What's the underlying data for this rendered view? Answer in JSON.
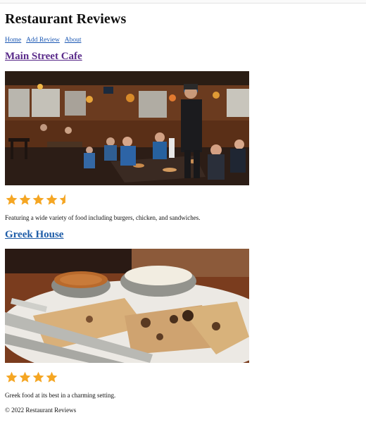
{
  "site": {
    "title": "Restaurant Reviews"
  },
  "nav": {
    "items": [
      {
        "label": "Home"
      },
      {
        "label": "Add Review"
      },
      {
        "label": "About"
      }
    ]
  },
  "restaurants": [
    {
      "name": "Main Street Cafe",
      "rating": 4.5,
      "max_rating": 5,
      "description": "Featuring a wide variety of food including burgers, chicken, and sandwiches."
    },
    {
      "name": "Greek House",
      "rating": 4,
      "max_rating": 5,
      "description": "Greek food at its best in a charming setting."
    }
  ],
  "footer": {
    "text": "© 2022 Restaurant Reviews"
  },
  "colors": {
    "star": "#f5a623",
    "link": "#1f5da8",
    "visited_link": "#5a2b8a"
  },
  "icons": {
    "rating": "star-icon"
  }
}
